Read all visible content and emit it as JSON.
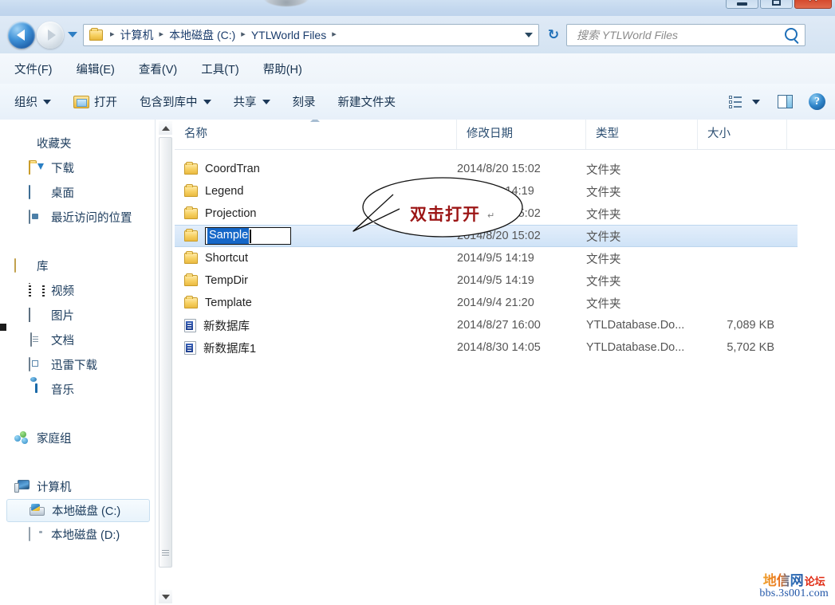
{
  "window": {
    "controls": {
      "minimize_label": "–",
      "maximize_label": "",
      "close_label": "✕"
    }
  },
  "address_bar": {
    "back_title": "后退",
    "forward_title": "前进",
    "history_title": "最近浏览的位置",
    "crumbs": [
      "计算机",
      "本地磁盘 (C:)",
      "YTLWorld Files"
    ],
    "separator": "▸",
    "refresh_label": "↻",
    "search_placeholder": "搜索 YTLWorld Files",
    "search_value": ""
  },
  "menubar": {
    "items": [
      {
        "label": "文件(F)"
      },
      {
        "label": "编辑(E)"
      },
      {
        "label": "查看(V)"
      },
      {
        "label": "工具(T)"
      },
      {
        "label": "帮助(H)"
      }
    ]
  },
  "toolbar": {
    "organize_label": "组织",
    "open_label": "打开",
    "include_library_label": "包含到库中",
    "share_label": "共享",
    "burn_label": "刻录",
    "new_folder_label": "新建文件夹",
    "help_label": "?"
  },
  "sidebar": {
    "groups": [
      {
        "header": {
          "label": "收藏夹",
          "icon": "star-icon"
        },
        "items": [
          {
            "label": "下载",
            "icon": "downloads-folder-icon"
          },
          {
            "label": "桌面",
            "icon": "desktop-icon"
          },
          {
            "label": "最近访问的位置",
            "icon": "recent-places-icon"
          }
        ]
      },
      {
        "header": {
          "label": "库",
          "icon": "library-icon"
        },
        "items": [
          {
            "label": "视频",
            "icon": "video-icon"
          },
          {
            "label": "图片",
            "icon": "pictures-icon"
          },
          {
            "label": "文档",
            "icon": "documents-icon"
          },
          {
            "label": "迅雷下载",
            "icon": "xunlei-icon"
          },
          {
            "label": "音乐",
            "icon": "music-icon"
          }
        ]
      },
      {
        "header": {
          "label": "家庭组",
          "icon": "homegroup-icon"
        },
        "items": []
      },
      {
        "header": {
          "label": "计算机",
          "icon": "computer-icon"
        },
        "items": [
          {
            "label": "本地磁盘 (C:)",
            "icon": "local-disk-c-icon",
            "selected": true
          },
          {
            "label": "本地磁盘 (D:)",
            "icon": "local-disk-d-icon",
            "selected": false
          }
        ]
      }
    ]
  },
  "filelist": {
    "columns": [
      {
        "key": "name",
        "label": "名称",
        "sorted": true
      },
      {
        "key": "date",
        "label": "修改日期"
      },
      {
        "key": "type",
        "label": "类型"
      },
      {
        "key": "size",
        "label": "大小"
      }
    ],
    "rows": [
      {
        "name": "CoordTran",
        "date": "2014/8/20 15:02",
        "type": "文件夹",
        "size": "",
        "icon": "folder-icon",
        "selected": false,
        "editing": false
      },
      {
        "name": "Legend",
        "date": "2014/9/5 14:19",
        "type": "文件夹",
        "size": "",
        "icon": "folder-icon",
        "selected": false,
        "editing": false
      },
      {
        "name": "Projection",
        "date": "2014/8/20 15:02",
        "type": "文件夹",
        "size": "",
        "icon": "folder-icon",
        "selected": false,
        "editing": false
      },
      {
        "name": "Sample",
        "date": "2014/8/20 15:02",
        "type": "文件夹",
        "size": "",
        "icon": "folder-icon",
        "selected": true,
        "editing": true
      },
      {
        "name": "Shortcut",
        "date": "2014/9/5 14:19",
        "type": "文件夹",
        "size": "",
        "icon": "folder-icon",
        "selected": false,
        "editing": false
      },
      {
        "name": "TempDir",
        "date": "2014/9/5 14:19",
        "type": "文件夹",
        "size": "",
        "icon": "folder-icon",
        "selected": false,
        "editing": false
      },
      {
        "name": "Template",
        "date": "2014/9/4 21:20",
        "type": "文件夹",
        "size": "",
        "icon": "folder-icon",
        "selected": false,
        "editing": false
      },
      {
        "name": "新数据库",
        "date": "2014/8/27 16:00",
        "type": "YTLDatabase.Do...",
        "size": "7,089 KB",
        "icon": "database-file-icon",
        "selected": false,
        "editing": false
      },
      {
        "name": "新数据库1",
        "date": "2014/8/30 14:05",
        "type": "YTLDatabase.Do...",
        "size": "5,702 KB",
        "icon": "database-file-icon",
        "selected": false,
        "editing": false
      }
    ],
    "rename_value": "Sample"
  },
  "annotation": {
    "callout_text": "双击打开",
    "callout_mark": "↵",
    "callout_color": "#9c1616"
  },
  "watermark": {
    "cn_main": "地信网",
    "cn_sub": "论坛",
    "url": "bbs.3s001.com"
  },
  "colors": {
    "selection_blue": "#1567c8",
    "row_selected": "#cfe3f7",
    "accent": "#2f7fc4"
  }
}
